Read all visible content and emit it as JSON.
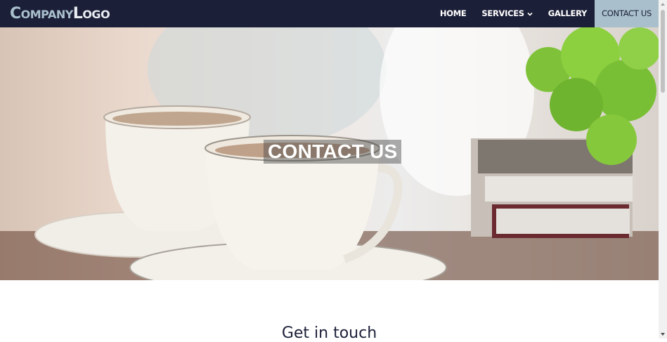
{
  "header": {
    "logo": {
      "company_cap": "C",
      "company_rest": "OMPANY",
      "logo_cap": "L",
      "logo_rest": "OGO"
    },
    "nav": [
      {
        "label": "HOME"
      },
      {
        "label": "SERVICES"
      },
      {
        "label": "GALLERY"
      },
      {
        "label": "CONTACT US"
      }
    ]
  },
  "hero": {
    "title": "CONTACT US",
    "image": "teacups-and-books-photo"
  },
  "main": {
    "section_title": "Get in touch"
  },
  "colors": {
    "navbar": "#1c1f38",
    "accent": "#a9c0cc"
  }
}
